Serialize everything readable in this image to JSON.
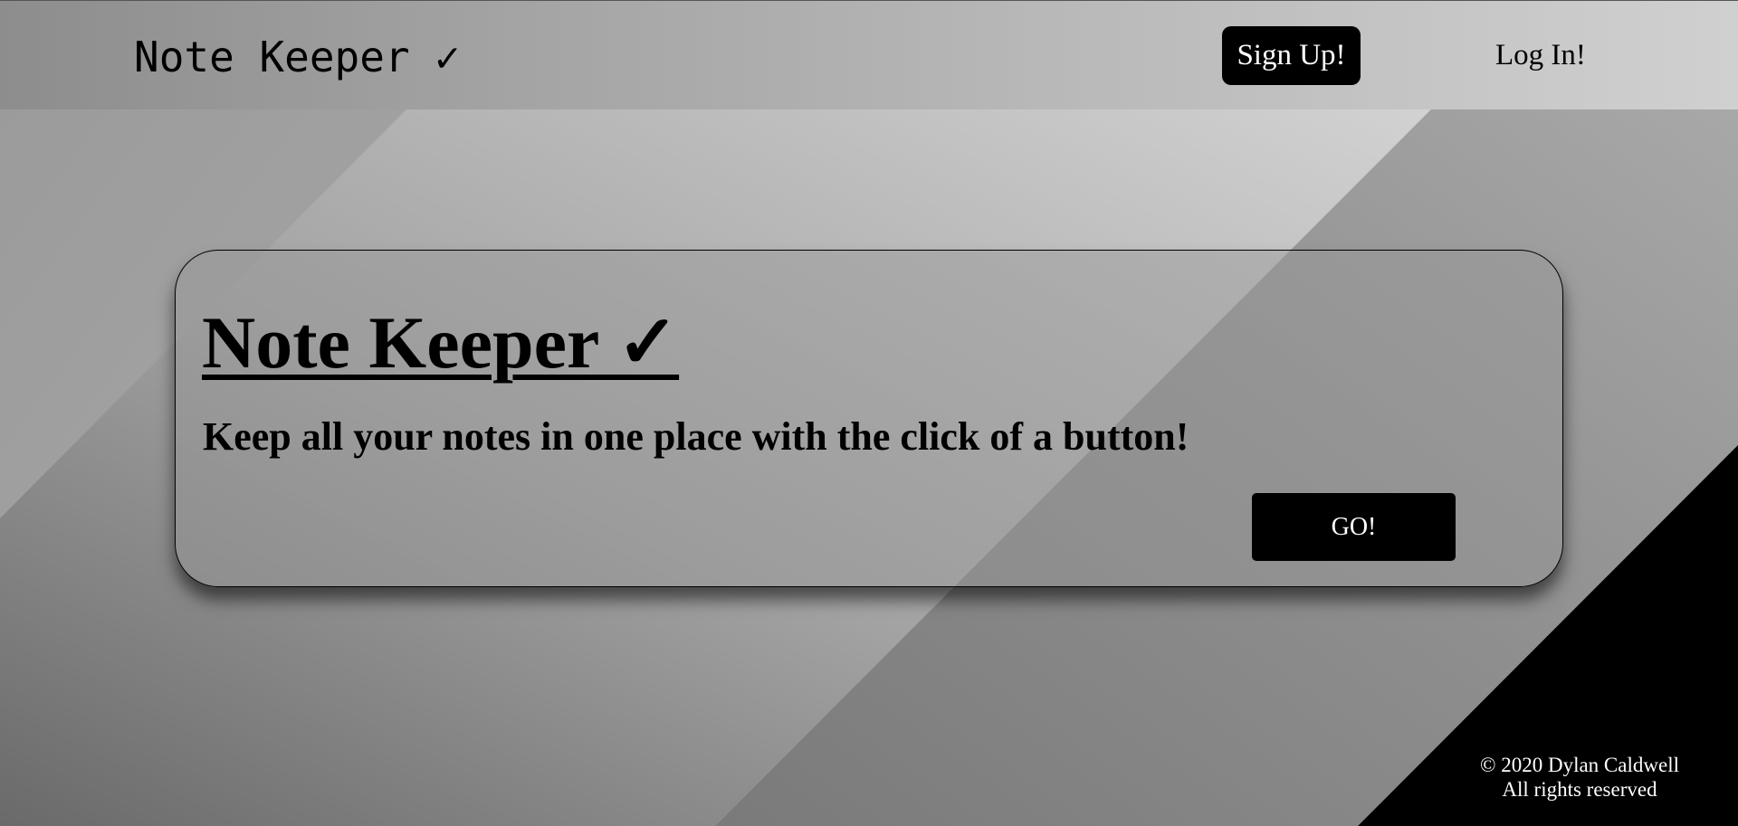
{
  "header": {
    "brand": "Note Keeper ✓",
    "signup_label": "Sign Up!",
    "login_label": "Log In!"
  },
  "hero": {
    "title": "Note Keeper ✓",
    "subtitle": "Keep all your notes in one place with the click of a button!",
    "go_label": "GO!"
  },
  "footer": {
    "copyright": "© 2020 Dylan Caldwell",
    "rights": "All rights reserved"
  },
  "colors": {
    "button_bg": "#000000",
    "button_text": "#ffffff",
    "text": "#000000"
  }
}
